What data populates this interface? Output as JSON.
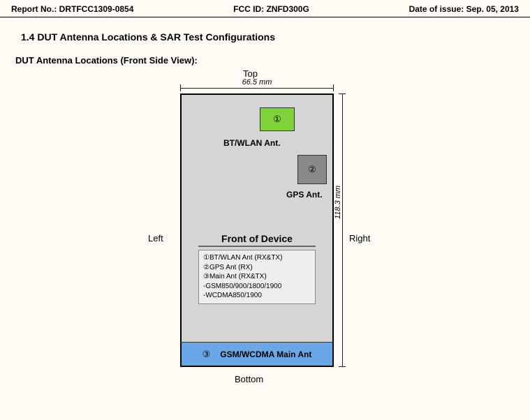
{
  "header": {
    "reportNoLabel": "Report No.:",
    "reportNo": "DRTFCC1309-0854",
    "fccIdLabel": "FCC ID:",
    "fccId": "ZNFD300G",
    "dateLabel": "Date of issue:",
    "date": "Sep. 05, 2013"
  },
  "sectionTitle": "1.4 DUT Antenna Locations & SAR Test Configurations",
  "subheading": "DUT Antenna Locations (Front Side View):",
  "sides": {
    "top": "Top",
    "left": "Left",
    "right": "Right",
    "bottom": "Bottom"
  },
  "dimensions": {
    "width": "66.5 mm",
    "height": "118.3 mm"
  },
  "antennas": {
    "a1": {
      "num": "①",
      "label": "BT/WLAN Ant."
    },
    "a2": {
      "num": "②",
      "label": "GPS Ant."
    },
    "a3": {
      "num": "③",
      "label": "GSM/WCDMA Main Ant"
    }
  },
  "legend": {
    "title": "Front of Device",
    "lines": [
      "①BT/WLAN Ant (RX&TX)",
      "②GPS Ant (RX)",
      "③Main Ant (RX&TX)",
      "-GSM850/900/1800/1900",
      "-WCDMA850/1900"
    ]
  }
}
